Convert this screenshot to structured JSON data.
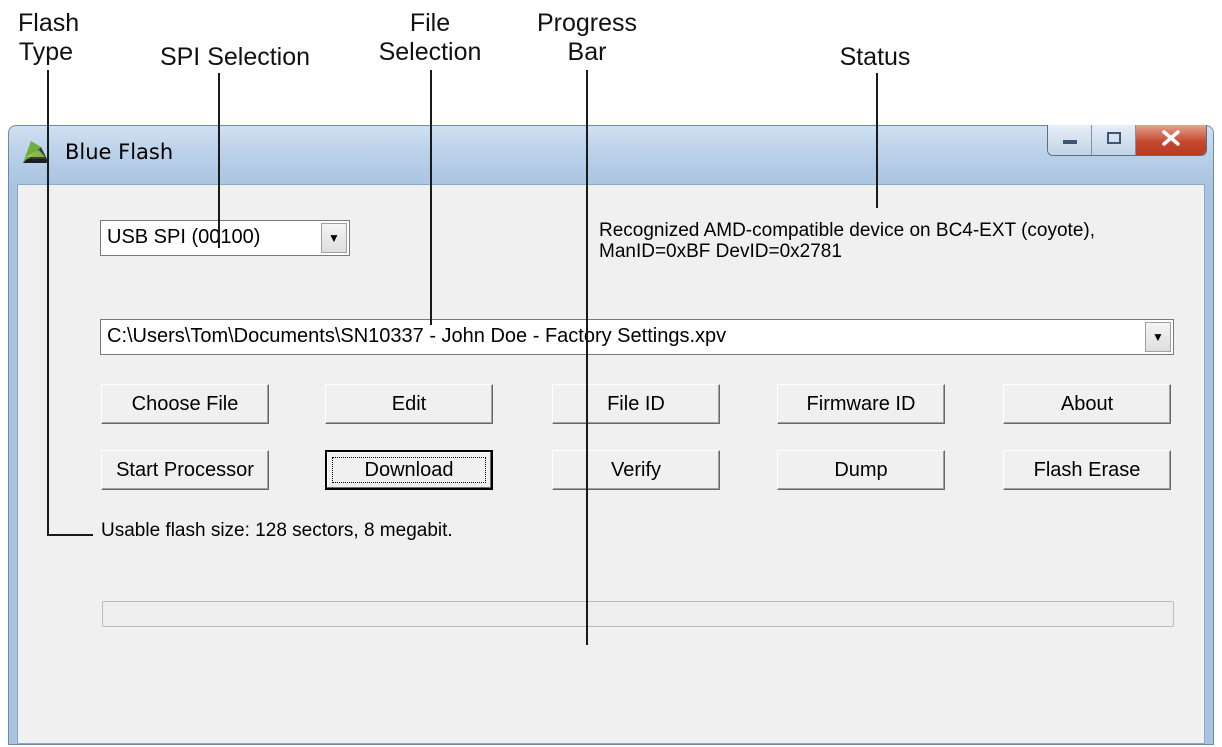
{
  "annotations": {
    "flash_type": [
      "Flash",
      "Type"
    ],
    "spi_selection": "SPI Selection",
    "file_selection": [
      "File",
      "Selection"
    ],
    "progress_bar": [
      "Progress",
      "Bar"
    ],
    "status": "Status"
  },
  "window": {
    "title": "Blue Flash",
    "icon": "blue-flash-app-icon",
    "controls": [
      "minimize-icon",
      "maximize-icon",
      "close-icon"
    ]
  },
  "spi": {
    "selected": "USB SPI (00100)"
  },
  "status": {
    "line1": "Recognized AMD-compatible device on BC4-EXT (coyote),",
    "line2": "ManID=0xBF DevID=0x2781"
  },
  "file": {
    "selected": "C:\\Users\\Tom\\Documents\\SN10337 - John Doe - Factory Settings.xpv"
  },
  "buttons": {
    "choose_file": "Choose File",
    "edit": "Edit",
    "file_id": "File ID",
    "firmware_id": "Firmware ID",
    "about": "About",
    "start_processor": "Start Processor",
    "download": "Download",
    "verify": "Verify",
    "dump": "Dump",
    "flash_erase": "Flash Erase"
  },
  "flash_info": "Usable flash size: 128 sectors, 8 megabit.",
  "progress": {
    "fraction": 0
  },
  "colors": {
    "progress_fill": "#41b043",
    "close_button": "#c44a2f"
  }
}
